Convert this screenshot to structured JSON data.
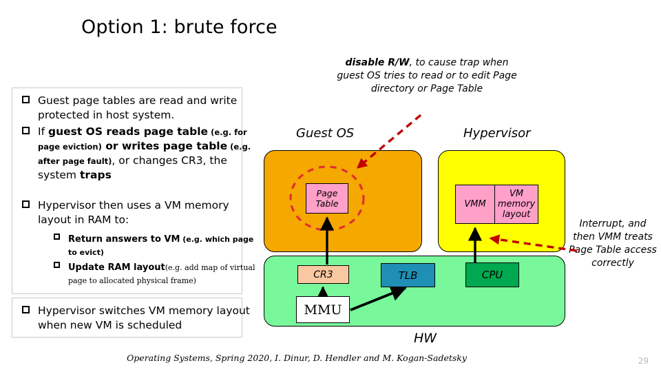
{
  "slide": {
    "title": "Option 1: brute force",
    "page_number": "29",
    "footer": "Operating Systems, Spring 2020, I. Dinur, D. Hendler and M. Kogan-Sadetsky"
  },
  "bullets": {
    "b1": {
      "text": "Guest page tables are read and write protected in host system."
    },
    "b2": {
      "lead": "If ",
      "bold1": "guest OS reads page table",
      "paren1": " (e.g. for page eviction)",
      "bold2": " or writes page table",
      "paren2": " (e.g. after page fault)",
      "mid": ", or changes CR3, the system ",
      "bold3": "traps"
    },
    "b3": {
      "text": "Hypervisor then uses a VM memory layout in RAM to:"
    },
    "sub1": {
      "bold": "Return answers to VM",
      "paren": " (e.g. which page to evict)"
    },
    "sub2": {
      "bold": "Update RAM layout",
      "paren": "(e.g. add map of virtual page to allocated physical frame)"
    },
    "b4": {
      "text": "Hypervisor switches VM memory layout when new VM is scheduled"
    }
  },
  "annotations": {
    "top": {
      "emphasis": "disable R/W",
      "rest": ", to cause trap when guest OS tries to read or to edit Page directory or Page Table"
    },
    "right": {
      "text": "Interrupt, and then VMM treats Page Table access correctly"
    }
  },
  "diagram": {
    "labels": {
      "guest_os": "Guest OS",
      "hypervisor": "Hypervisor",
      "hw": "HW"
    },
    "boxes": {
      "page_table": "Page Table",
      "vmm": "VMM",
      "vm_memory_layout": "VM memory layout",
      "cr3": "CR3",
      "tlb": "TLB",
      "cpu": "CPU",
      "mmu": "MMU"
    },
    "colors": {
      "guest_os_fill": "#f5a800",
      "hypervisor_fill": "#ffff00",
      "hw_fill": "#79f79b",
      "page_table_fill": "#ffa0c9",
      "vmm_fill": "#ffa0c9",
      "vm_memory_layout_fill": "#ffa0c9",
      "cr3_fill": "#fac8a0",
      "tlb_fill": "#1f8fb5",
      "cpu_fill": "#00a84f",
      "mmu_fill": "#ffffff",
      "callout_arrow": "#c00000",
      "highlight_circle": "#e03030",
      "solid_arrow": "#000000"
    }
  }
}
